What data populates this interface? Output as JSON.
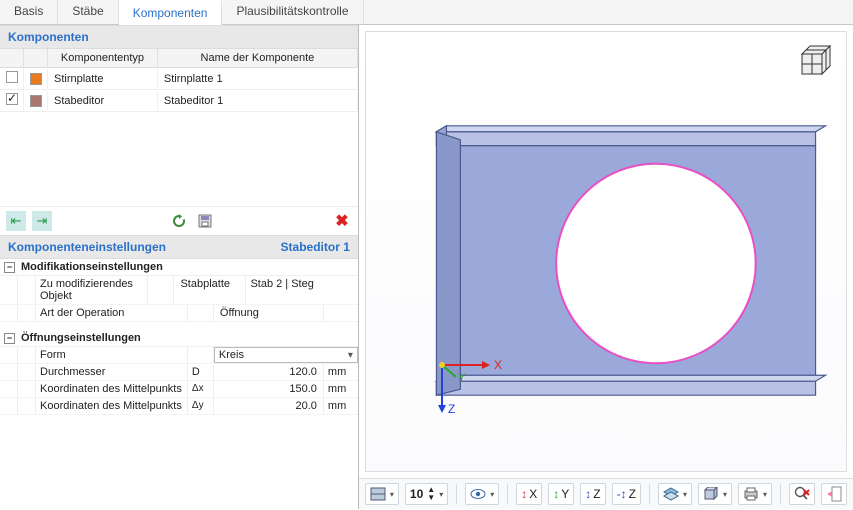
{
  "tabs": [
    "Basis",
    "Stäbe",
    "Komponenten",
    "Plausibilitätskontrolle"
  ],
  "active_tab": "Komponenten",
  "components_panel": {
    "title": "Komponenten",
    "headers": {
      "type": "Komponententyp",
      "name": "Name der Komponente"
    },
    "rows": [
      {
        "checked": false,
        "color": "#e77b1e",
        "type": "Stirnplatte",
        "name": "Stirnplatte 1"
      },
      {
        "checked": true,
        "color": "#a9776f",
        "type": "Stabeditor",
        "name": "Stabeditor 1"
      }
    ]
  },
  "settings_panel": {
    "title": "Komponenteneinstellungen",
    "subtitle": "Stabeditor 1",
    "groups": [
      {
        "label": "Modifikationseinstellungen",
        "rows": [
          {
            "label": "Zu modifizierendes Objekt",
            "symbol": "",
            "value": "Stabplatte",
            "extra": "Stab 2 | Steg",
            "unit": ""
          },
          {
            "label": "Art der Operation",
            "symbol": "",
            "value": "Öffnung",
            "unit": ""
          }
        ]
      },
      {
        "label": "Öffnungseinstellungen",
        "rows": [
          {
            "label": "Form",
            "symbol": "",
            "value": "Kreis",
            "unit": "",
            "dropdown": true
          },
          {
            "label": "Durchmesser",
            "symbol": "D",
            "value": "120.0",
            "unit": "mm"
          },
          {
            "label": "Koordinaten des Mittelpunkts",
            "symbol": "Δx",
            "value": "150.0",
            "unit": "mm"
          },
          {
            "label": "Koordinaten des Mittelpunkts",
            "symbol": "Δy",
            "value": "20.0",
            "unit": "mm"
          }
        ]
      }
    ]
  },
  "status_axes": [
    "X",
    "Y",
    "Z",
    "Z"
  ],
  "status_zoom": "10",
  "viewport_axes": {
    "x": "X",
    "y": "Y",
    "z": "Z"
  },
  "colors": {
    "beam_flange": "#b4bde0",
    "beam_web": "#9aa8da",
    "beam_edge": "#4a588e",
    "hole_outline": "#e94fc4"
  }
}
